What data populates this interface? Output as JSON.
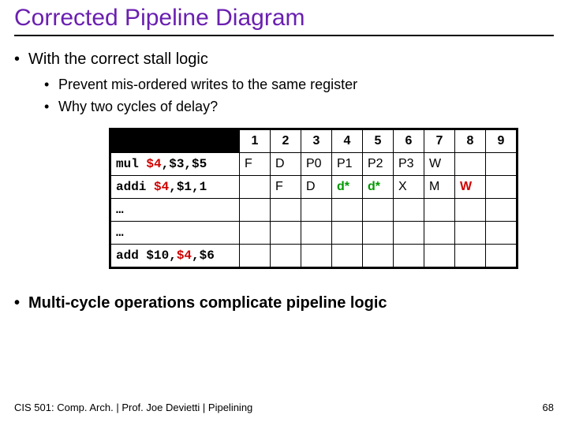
{
  "title": "Corrected Pipeline Diagram",
  "bullets": {
    "lvl1_a": "With the correct stall logic",
    "lvl2_a": "Prevent mis-ordered writes to the same register",
    "lvl2_b": "Why two cycles of delay?"
  },
  "table": {
    "cycles": [
      "1",
      "2",
      "3",
      "4",
      "5",
      "6",
      "7",
      "8",
      "9"
    ],
    "rows": [
      {
        "instr_pre": "mul ",
        "instr_dest": "$4",
        "instr_post": ",$3,$5",
        "cells": [
          "F",
          "D",
          "P0",
          "P1",
          "P2",
          "P3",
          "W",
          "",
          ""
        ]
      },
      {
        "instr_pre": "addi ",
        "instr_dest": "$4",
        "instr_post": ",$1,1",
        "cells": [
          "",
          "F",
          "D",
          "d*",
          "d*",
          "X",
          "M",
          "W",
          ""
        ]
      },
      {
        "instr_pre": "…",
        "instr_dest": "",
        "instr_post": "",
        "cells": [
          "",
          "",
          "",
          "",
          "",
          "",
          "",
          "",
          ""
        ]
      },
      {
        "instr_pre": "…",
        "instr_dest": "",
        "instr_post": "",
        "cells": [
          "",
          "",
          "",
          "",
          "",
          "",
          "",
          "",
          ""
        ]
      },
      {
        "instr_pre": "add $10,",
        "instr_dest": "$4",
        "instr_post": ",$6",
        "cells": [
          "",
          "",
          "",
          "",
          "",
          "",
          "",
          "",
          ""
        ]
      }
    ]
  },
  "stall_marker": "d*",
  "wb_late": "W",
  "conclusion": "Multi-cycle operations complicate pipeline logic",
  "footer": {
    "left": "CIS 501: Comp. Arch.  |  Prof. Joe Devietti  |  Pipelining",
    "right": "68"
  }
}
